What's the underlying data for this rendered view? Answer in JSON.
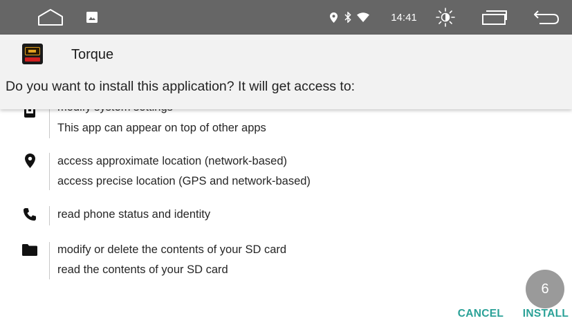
{
  "status_bar": {
    "time": "14:41",
    "icons": [
      "home-icon",
      "image-icon",
      "location-icon",
      "bluetooth-icon",
      "wifi-icon",
      "brightness-icon",
      "recent-apps-icon",
      "back-icon"
    ]
  },
  "app": {
    "name": "Torque",
    "icon": "obd-check-icon"
  },
  "prompt": "Do you want to install this application? It will get access to:",
  "permissions": [
    {
      "icon": "settings-phone-icon",
      "lines": [
        "modify system settings",
        "This app can appear on top of other apps"
      ]
    },
    {
      "icon": "location-pin-icon",
      "lines": [
        "access approximate location (network-based)",
        "access precise location (GPS and network-based)"
      ]
    },
    {
      "icon": "phone-icon",
      "lines": [
        "read phone status and identity"
      ]
    },
    {
      "icon": "folder-icon",
      "lines": [
        "modify or delete the contents of your SD card",
        "read the contents of your SD card"
      ]
    }
  ],
  "countdown": "6",
  "buttons": {
    "cancel": "CANCEL",
    "install": "INSTALL"
  },
  "colors": {
    "status_bar": "#666666",
    "header_bg": "#f2f2f2",
    "accent": "#2aa197",
    "countdown_bg": "#9a9a9a"
  }
}
